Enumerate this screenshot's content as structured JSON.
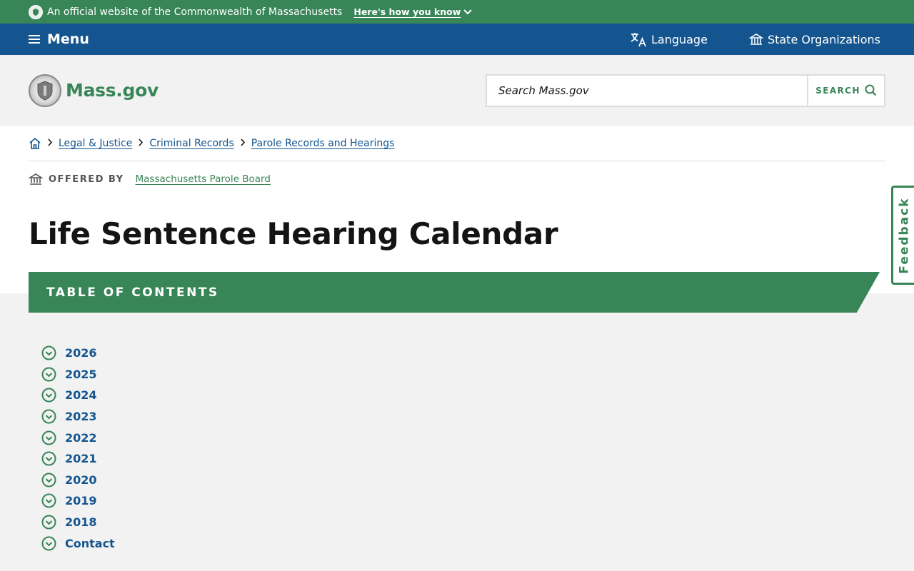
{
  "banner": {
    "text": "An official website of the Commonwealth of Massachusetts",
    "how_label": "Here's how you know"
  },
  "nav": {
    "menu_label": "Menu",
    "language_label": "Language",
    "state_orgs_label": "State Organizations"
  },
  "header": {
    "logo_text": "Mass.gov",
    "search_placeholder": "Search Mass.gov",
    "search_button": "SEARCH"
  },
  "breadcrumbs": [
    "Legal & Justice",
    "Criminal Records",
    "Parole Records and Hearings"
  ],
  "offered_by": {
    "label": "OFFERED BY",
    "org": "Massachusetts Parole Board"
  },
  "page_title": "Life Sentence Hearing Calendar",
  "toc": {
    "title": "TABLE OF CONTENTS",
    "items": [
      "2026",
      "2025",
      "2024",
      "2023",
      "2022",
      "2021",
      "2020",
      "2019",
      "2018",
      "Contact"
    ]
  },
  "feedback_label": "Feedback",
  "colors": {
    "green": "#388557",
    "blue": "#14558f",
    "gray_bg": "#f2f2f2"
  }
}
